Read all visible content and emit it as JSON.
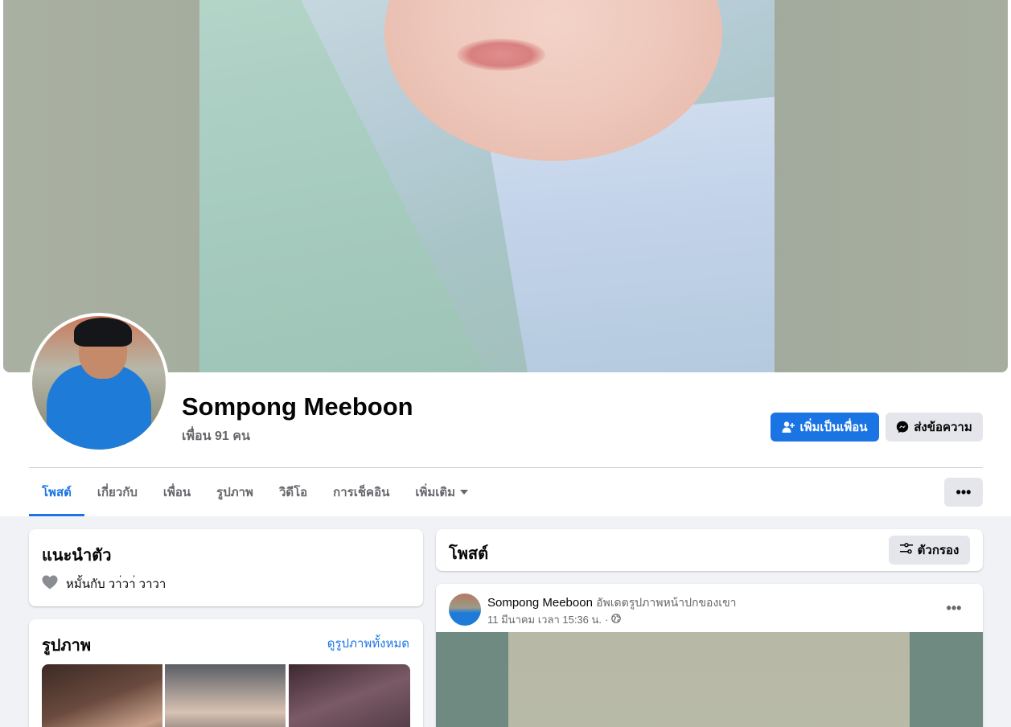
{
  "profile": {
    "name": "Sompong Meeboon",
    "friends_count": "เพื่อน 91 คน"
  },
  "actions": {
    "add_friend_label": "เพิ่มเป็นเพื่อน",
    "message_label": "ส่งข้อความ"
  },
  "tabs": [
    {
      "label": "โพสต์",
      "active": true
    },
    {
      "label": "เกี่ยวกับ",
      "active": false
    },
    {
      "label": "เพื่อน",
      "active": false
    },
    {
      "label": "รูปภาพ",
      "active": false
    },
    {
      "label": "วิดีโอ",
      "active": false
    },
    {
      "label": "การเช็คอิน",
      "active": false
    },
    {
      "label": "เพิ่มเติม",
      "active": false
    }
  ],
  "more_label": "•••",
  "intro": {
    "title": "แนะนำตัว",
    "relationship": "หมั้นกับ วา่วา่ วาวา"
  },
  "photos": {
    "title": "รูปภาพ",
    "see_all": "ดูรูปภาพทั้งหมด"
  },
  "posts": {
    "title": "โพสต์",
    "filter_label": "ตัวกรอง",
    "items": [
      {
        "author": "Sompong Meeboon",
        "action": "อัพเดตรูปภาพหน้าปกของเขา",
        "timestamp": "11 มีนาคม เวลา 15:36 น.",
        "dots": "•••"
      }
    ]
  },
  "colors": {
    "accent": "#1b74e4",
    "secondary_button": "#e4e6eb",
    "page_background": "#f0f2f5"
  },
  "icons": [
    "add-friend-icon",
    "messenger-icon",
    "heart-icon",
    "filter-icon",
    "globe-icon",
    "chevron-down-icon",
    "more-icon"
  ]
}
